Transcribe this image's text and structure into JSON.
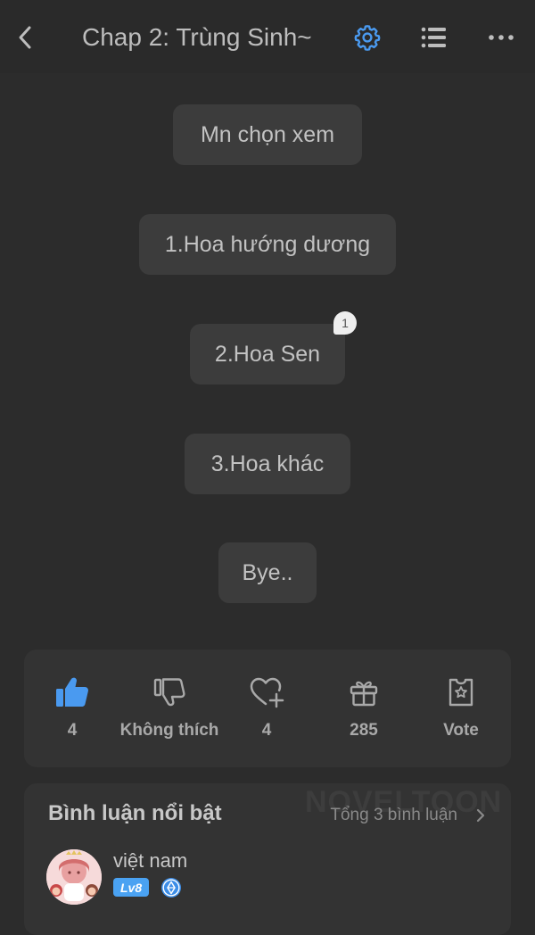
{
  "header": {
    "title": "Chap 2: Trùng Sinh~",
    "icons": [
      "back-icon",
      "gear-icon",
      "list-icon",
      "more-icon"
    ],
    "accent": "#4a9af0"
  },
  "chapter": {
    "messages": [
      {
        "text": "Mn chọn xem"
      },
      {
        "text": "1.Hoa hướng dương"
      },
      {
        "text": "2.Hoa Sen",
        "comment_count": "1"
      },
      {
        "text": "3.Hoa khác"
      },
      {
        "text": "Bye.."
      }
    ]
  },
  "actions": {
    "like": {
      "label": "4",
      "icon": "thumbs-up-icon",
      "active": true
    },
    "dislike": {
      "label": "Không thích",
      "icon": "thumbs-down-icon"
    },
    "favorite": {
      "label": "4",
      "icon": "heart-plus-icon"
    },
    "gift": {
      "label": "285",
      "icon": "gift-icon"
    },
    "vote": {
      "label": "Vote",
      "icon": "vote-ticket-icon"
    }
  },
  "comments": {
    "title": "Bình luận nổi bật",
    "total": "Tổng 3 bình luận",
    "watermark": "NOVELTOON",
    "top_comment": {
      "username": "việt nam",
      "level": "Lv8"
    }
  }
}
